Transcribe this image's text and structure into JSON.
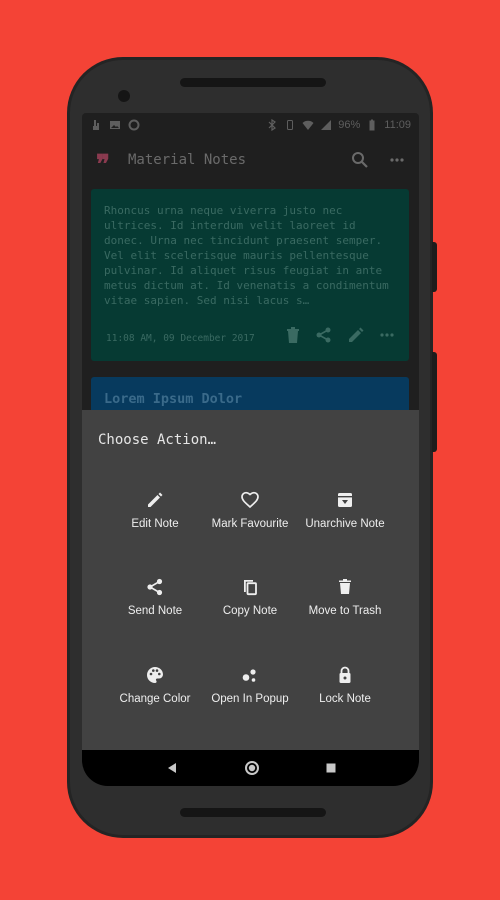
{
  "statusbar": {
    "battery": "96%",
    "time": "11:09"
  },
  "appbar": {
    "title": "Material Notes",
    "logo_icon": "quote-icon",
    "logo_color": "#8a3a4f"
  },
  "notes": [
    {
      "text": "Rhoncus urna neque viverra justo nec ultrices. Id interdum velit laoreet id donec. Urna nec tincidunt praesent semper. Vel elit scelerisque mauris pellentesque pulvinar. Id aliquet risus feugiat in ante metus dictum at. Id venenatis a condimentum vitae sapien. Sed nisi lacus s…",
      "date": "11:08 AM, 09 December 2017",
      "color": "#063a33"
    },
    {
      "title": "Lorem Ipsum Dolor",
      "color": "#073a5e"
    }
  ],
  "sheet": {
    "title": "Choose Action…",
    "actions": [
      {
        "label": "Edit Note",
        "icon": "pencil-icon"
      },
      {
        "label": "Mark Favourite",
        "icon": "heart-outline-icon"
      },
      {
        "label": "Unarchive Note",
        "icon": "unarchive-icon"
      },
      {
        "label": "Send Note",
        "icon": "share-icon"
      },
      {
        "label": "Copy Note",
        "icon": "copy-icon"
      },
      {
        "label": "Move to Trash",
        "icon": "trash-icon"
      },
      {
        "label": "Change Color",
        "icon": "palette-icon"
      },
      {
        "label": "Open In Popup",
        "icon": "bubbles-icon"
      },
      {
        "label": "Lock Note",
        "icon": "lock-icon"
      }
    ]
  },
  "colors": {
    "background": "#f44336",
    "sheet": "#424242"
  }
}
